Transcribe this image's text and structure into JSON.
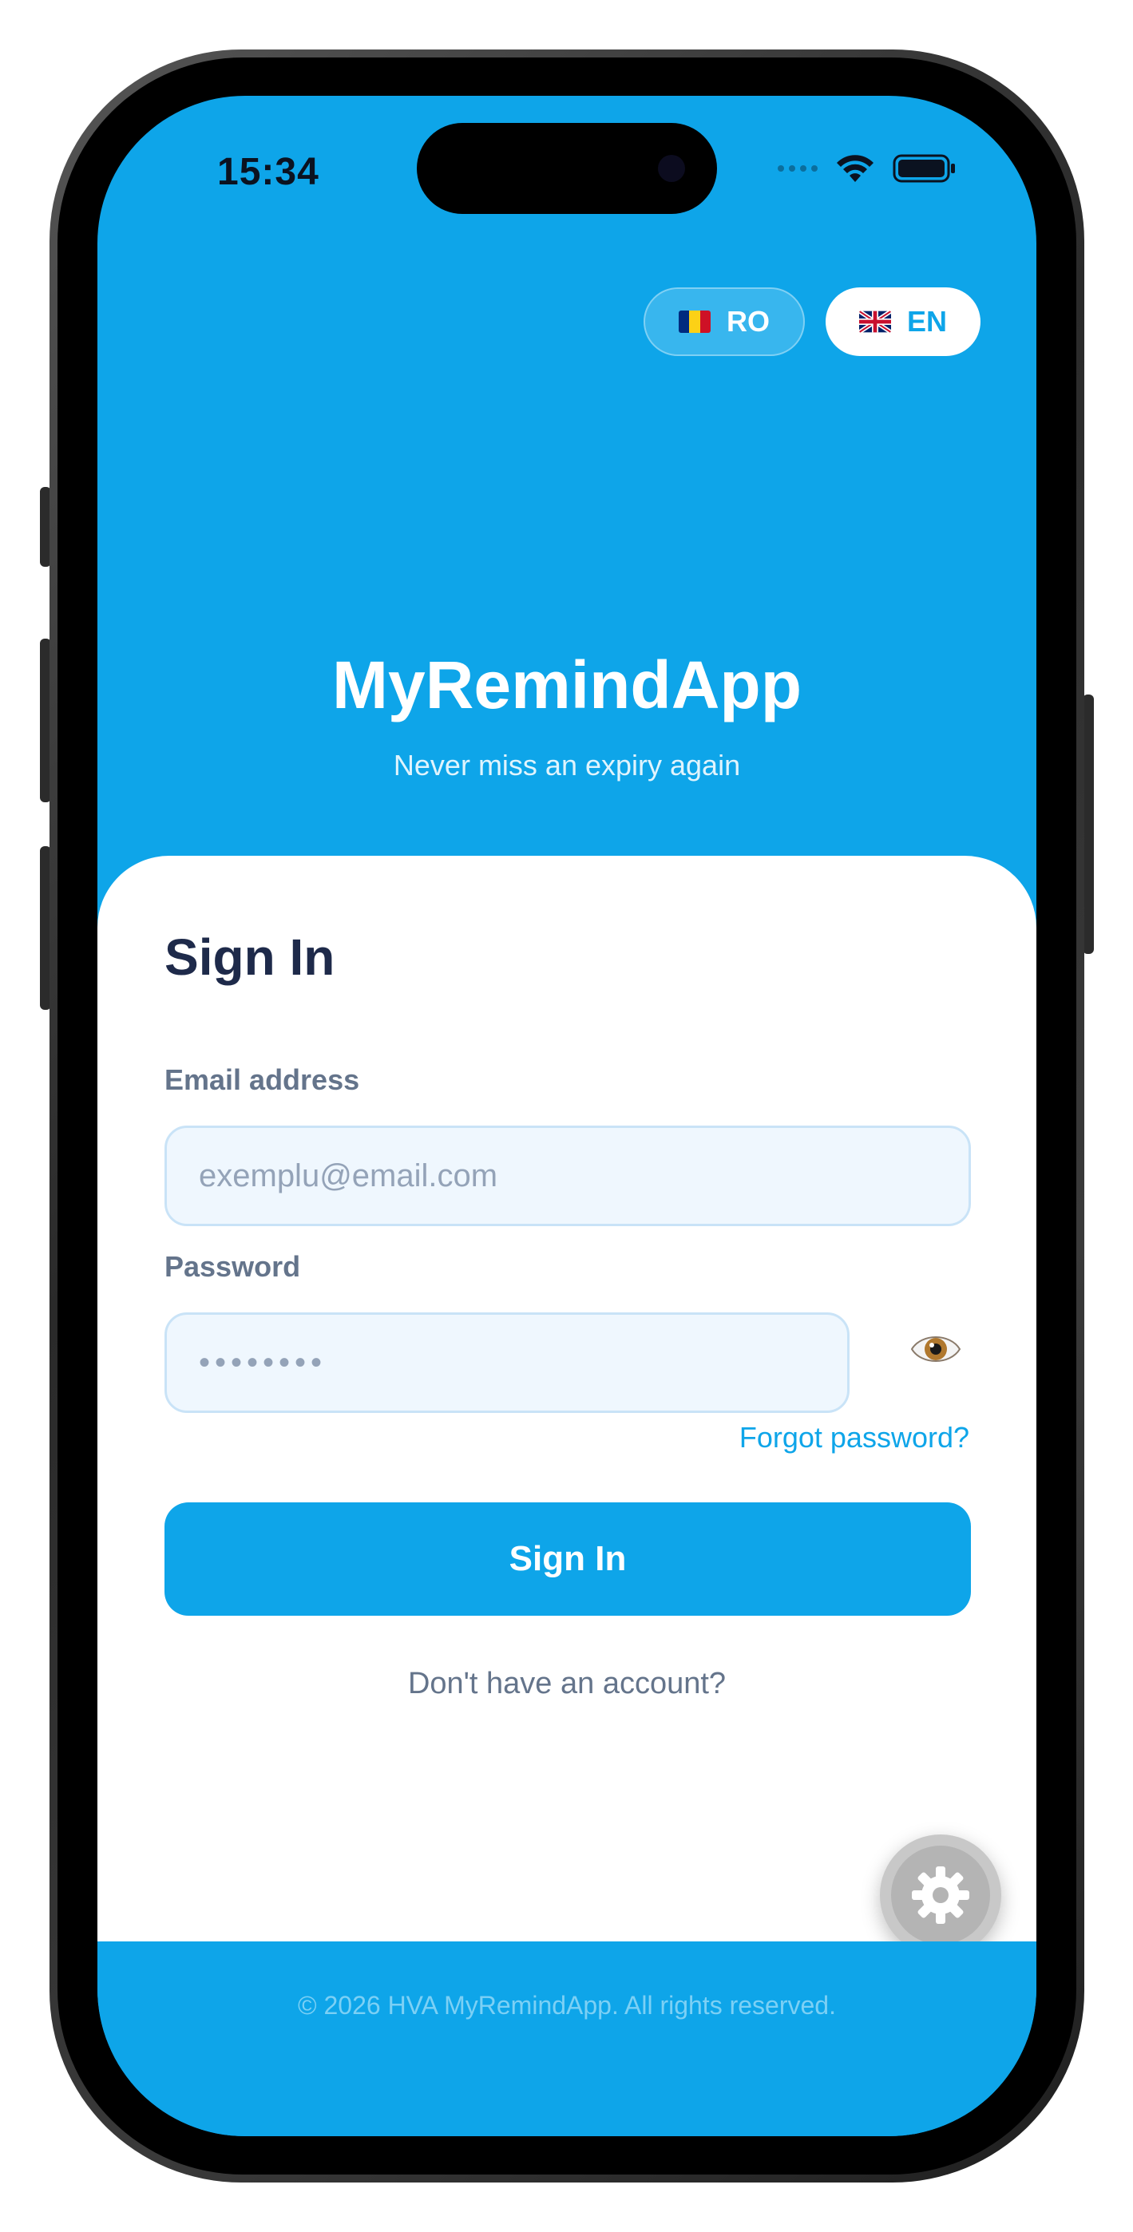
{
  "status_bar": {
    "time": "15:34"
  },
  "language": {
    "options": [
      {
        "code": "RO",
        "selected": false
      },
      {
        "code": "EN",
        "selected": true
      }
    ]
  },
  "header": {
    "app_name": "MyRemindApp",
    "tagline": "Never miss an expiry again"
  },
  "sign_in": {
    "title": "Sign In",
    "email_label": "Email address",
    "email_placeholder": "exemplu@email.com",
    "email_value": "",
    "password_label": "Password",
    "password_value": "••••••••",
    "forgot_link": "Forgot password?",
    "submit_label": "Sign In",
    "signup_prompt": "Don't have an account?"
  },
  "footer": {
    "copyright": "© 2026 HVA MyRemindApp. All rights reserved."
  },
  "colors": {
    "primary": "#0ea5e9",
    "card_bg": "#ffffff",
    "title_text": "#1e2a4a",
    "label_text": "#64748b",
    "input_bg": "#eff7fe"
  }
}
